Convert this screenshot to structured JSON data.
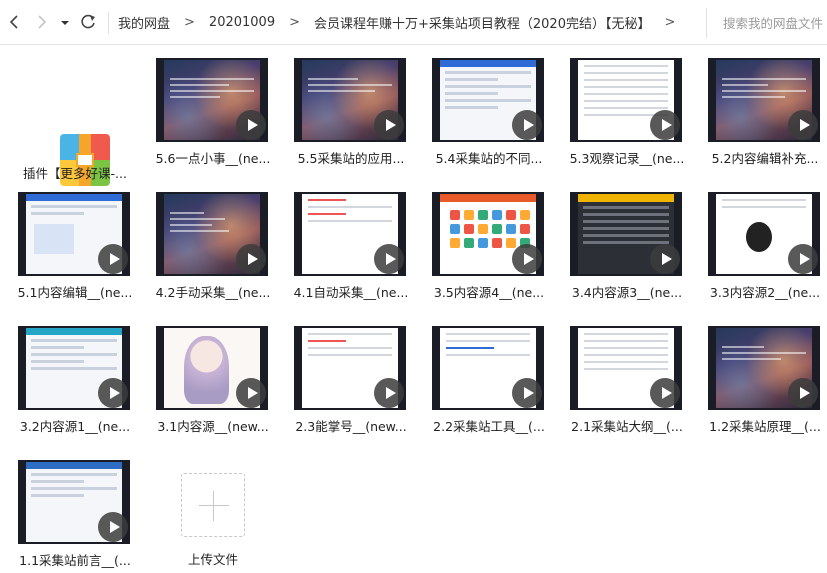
{
  "breadcrumb": [
    "我的网盘",
    "20201009",
    "会员课程年赚十万+采集站项目教程（2020完结）【无秘】"
  ],
  "breadcrumb_sep": ">",
  "search": {
    "placeholder": "搜索我的网盘文件"
  },
  "icons": {
    "back": "chevron-left-icon",
    "forward": "chevron-right-icon",
    "history": "caret-down-icon",
    "refresh": "refresh-icon",
    "play": "play-icon",
    "archive": "archive-icon",
    "upload": "plus-icon"
  },
  "colors": {
    "accent": "#2e6bd6",
    "play_overlay": "#3c3c3c"
  },
  "files": [
    {
      "name": "插件【更多好课-...",
      "type": "archive"
    },
    {
      "name": "5.6一点小事__(ne...",
      "type": "video"
    },
    {
      "name": "5.5采集站的应用...",
      "type": "video"
    },
    {
      "name": "5.4采集站的不同...",
      "type": "video"
    },
    {
      "name": "5.3观察记录__(ne...",
      "type": "video"
    },
    {
      "name": "5.2内容编辑补充...",
      "type": "video"
    },
    {
      "name": "5.1内容编辑__(ne...",
      "type": "video"
    },
    {
      "name": "4.2手动采集__(ne...",
      "type": "video"
    },
    {
      "name": "4.1自动采集__(ne...",
      "type": "video"
    },
    {
      "name": "3.5内容源4__(ne...",
      "type": "video"
    },
    {
      "name": "3.4内容源3__(ne...",
      "type": "video"
    },
    {
      "name": "3.3内容源2__(ne...",
      "type": "video"
    },
    {
      "name": "3.2内容源1__(ne...",
      "type": "video"
    },
    {
      "name": "3.1内容源__(new...",
      "type": "video"
    },
    {
      "name": "2.3能掌号__(new...",
      "type": "video"
    },
    {
      "name": "2.2采集站工具__(...",
      "type": "video"
    },
    {
      "name": "2.1采集站大纲__(...",
      "type": "video"
    },
    {
      "name": "1.2采集站原理__(...",
      "type": "video"
    },
    {
      "name": "1.1采集站前言__(...",
      "type": "video"
    }
  ],
  "upload": {
    "label": "上传文件"
  }
}
